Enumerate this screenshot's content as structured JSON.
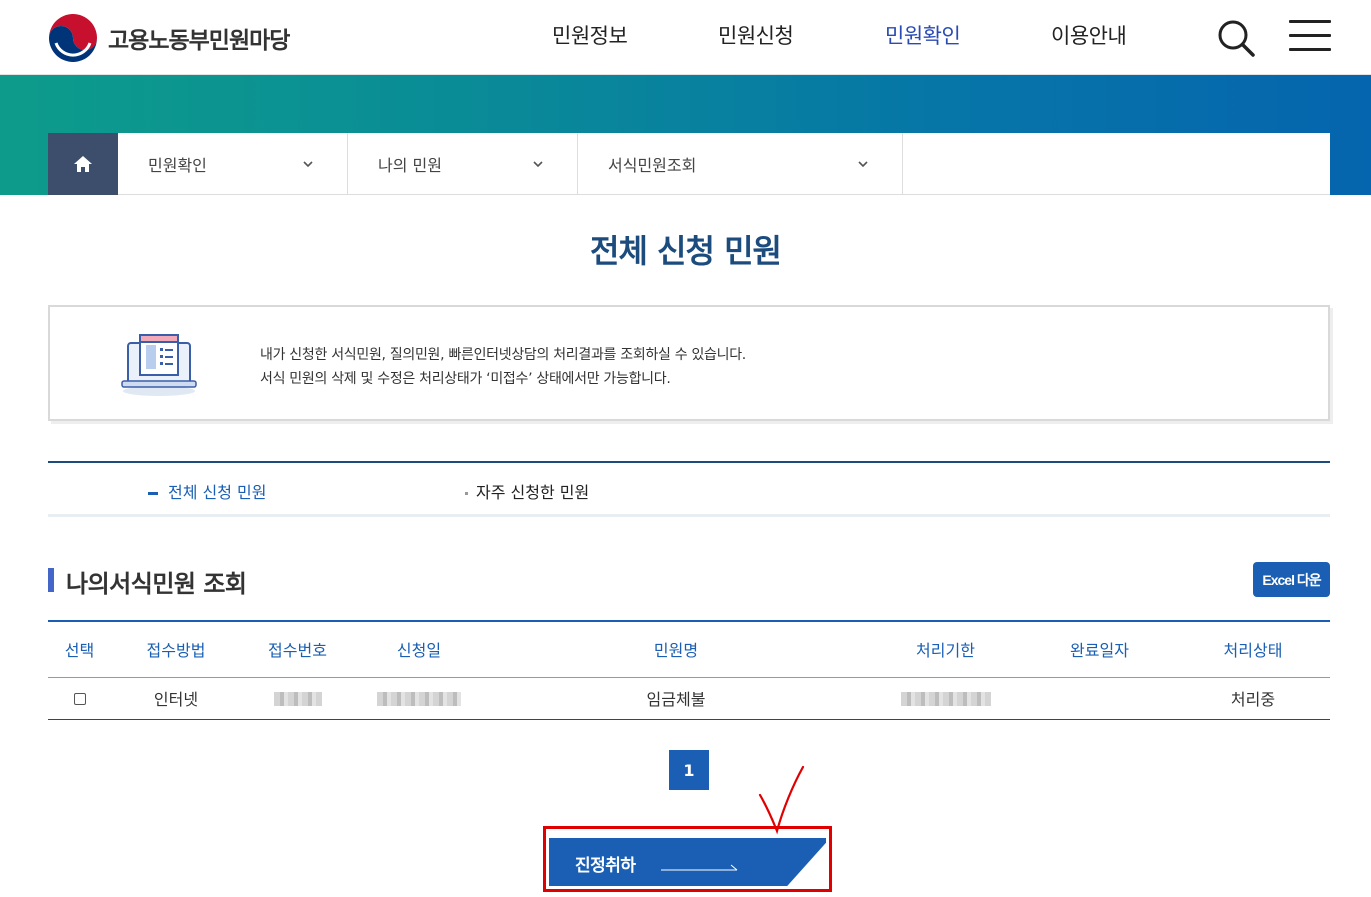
{
  "header": {
    "logo_text": "고용노동부민원마당",
    "nav": [
      {
        "label": "민원정보",
        "active": false
      },
      {
        "label": "민원신청",
        "active": false
      },
      {
        "label": "민원확인",
        "active": true
      },
      {
        "label": "이용안내",
        "active": false
      }
    ]
  },
  "breadcrumb": {
    "items": [
      {
        "label": "민원확인"
      },
      {
        "label": "나의 민원"
      },
      {
        "label": "서식민원조회"
      }
    ]
  },
  "page": {
    "title": "전체 신청 민원",
    "info_line1": "내가 신청한 서식민원, 질의민원, 빠른인터넷상담의 처리결과를 조회하실 수 있습니다.",
    "info_line2": "서식 민원의 삭제 및 수정은 처리상태가 ‘미접수’ 상태에서만 가능합니다."
  },
  "tabs": [
    {
      "label": "전체 신청 민원",
      "active": true
    },
    {
      "label": "자주 신청한 민원",
      "active": false
    }
  ],
  "section": {
    "title": "나의서식민원 조회",
    "excel_label": "Excel 다운"
  },
  "table": {
    "headers": [
      "선택",
      "접수방법",
      "접수번호",
      "신청일",
      "민원명",
      "처리기한",
      "완료일자",
      "처리상태"
    ],
    "rows": [
      {
        "method": "인터넷",
        "name": "임금체불",
        "status": "처리중"
      }
    ]
  },
  "pagination": {
    "current": "1"
  },
  "actions": {
    "cancel_label": "진정취하"
  },
  "colors": {
    "primary": "#1a5fb4",
    "navy": "#1c4b7e",
    "highlight": "#e10000"
  }
}
